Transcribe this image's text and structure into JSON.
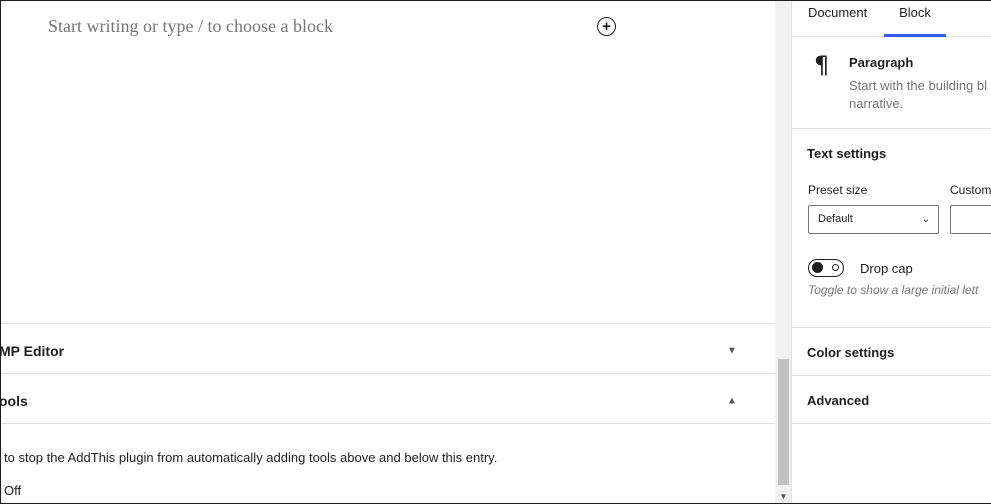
{
  "editor": {
    "placeholder": "Start writing or type / to choose a block",
    "add_block_icon": "plus-circle-icon"
  },
  "metaboxes": [
    {
      "title": "MP Editor",
      "arrow": "▼",
      "state": "collapsed"
    },
    {
      "title": "ools",
      "arrow": "▲",
      "state": "expanded"
    }
  ],
  "metabox_body": {
    "text": "to stop the AddThis plugin from automatically adding tools above and below this entry.",
    "off_label": "Off"
  },
  "sidebar": {
    "tabs": [
      {
        "label": "Document",
        "active": false
      },
      {
        "label": "Block",
        "active": true
      }
    ],
    "block_card": {
      "icon": "paragraph-icon",
      "title": "Paragraph",
      "description": "Start with the building bl narrative."
    },
    "text_settings": {
      "title": "Text settings",
      "preset_label": "Preset size",
      "preset_value": "Default",
      "custom_label": "Custom",
      "drop_cap_label": "Drop cap",
      "drop_cap_help": "Toggle to show a large initial lett",
      "drop_cap_on": false
    },
    "color_settings_title": "Color settings",
    "advanced_title": "Advanced"
  },
  "colors": {
    "accent": "#3858e9",
    "muted_text": "#757575",
    "border": "#e0e0e0"
  }
}
